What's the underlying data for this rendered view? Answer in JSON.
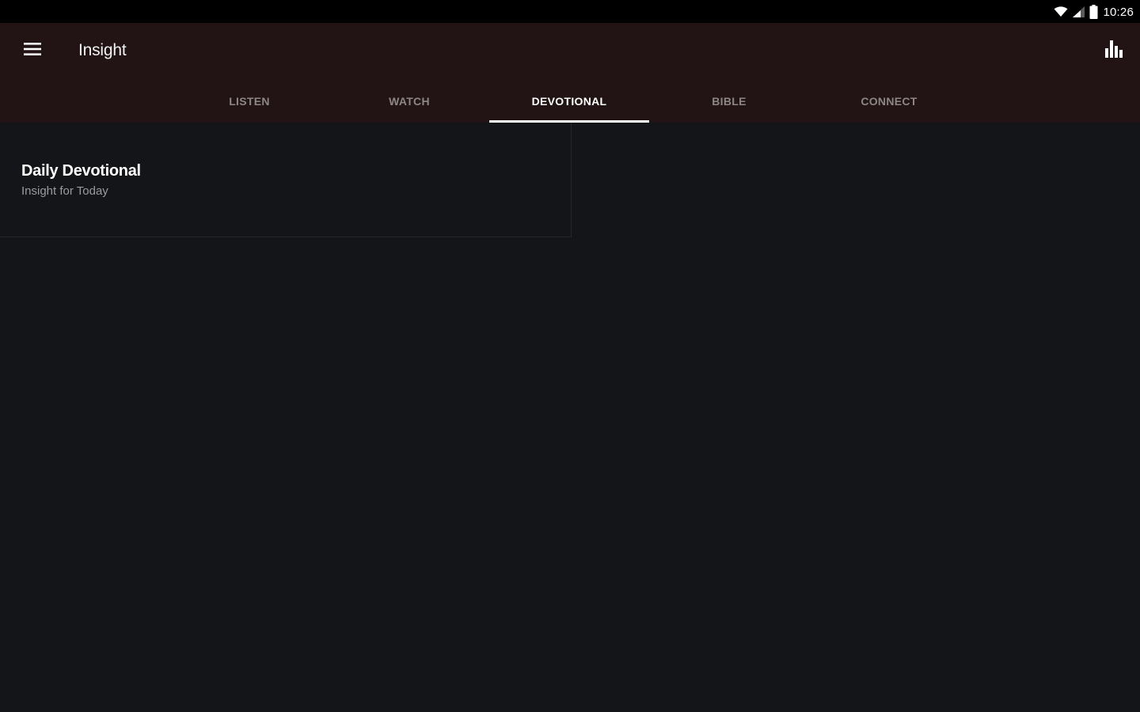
{
  "status_bar": {
    "time": "10:26",
    "icons": [
      "wifi-icon",
      "cell-signal-icon",
      "battery-icon"
    ]
  },
  "app_bar": {
    "title": "Insight",
    "menu_icon": "hamburger-menu-icon",
    "action_icon": "bar-chart-icon",
    "background": "#221314"
  },
  "tabs": [
    {
      "label": "LISTEN",
      "active": false
    },
    {
      "label": "WATCH",
      "active": false
    },
    {
      "label": "DEVOTIONAL",
      "active": true
    },
    {
      "label": "BIBLE",
      "active": false
    },
    {
      "label": "CONNECT",
      "active": false
    }
  ],
  "content": {
    "cards": [
      {
        "title": "Daily Devotional",
        "subtitle": "Insight for Today"
      }
    ],
    "background": "#141518"
  }
}
